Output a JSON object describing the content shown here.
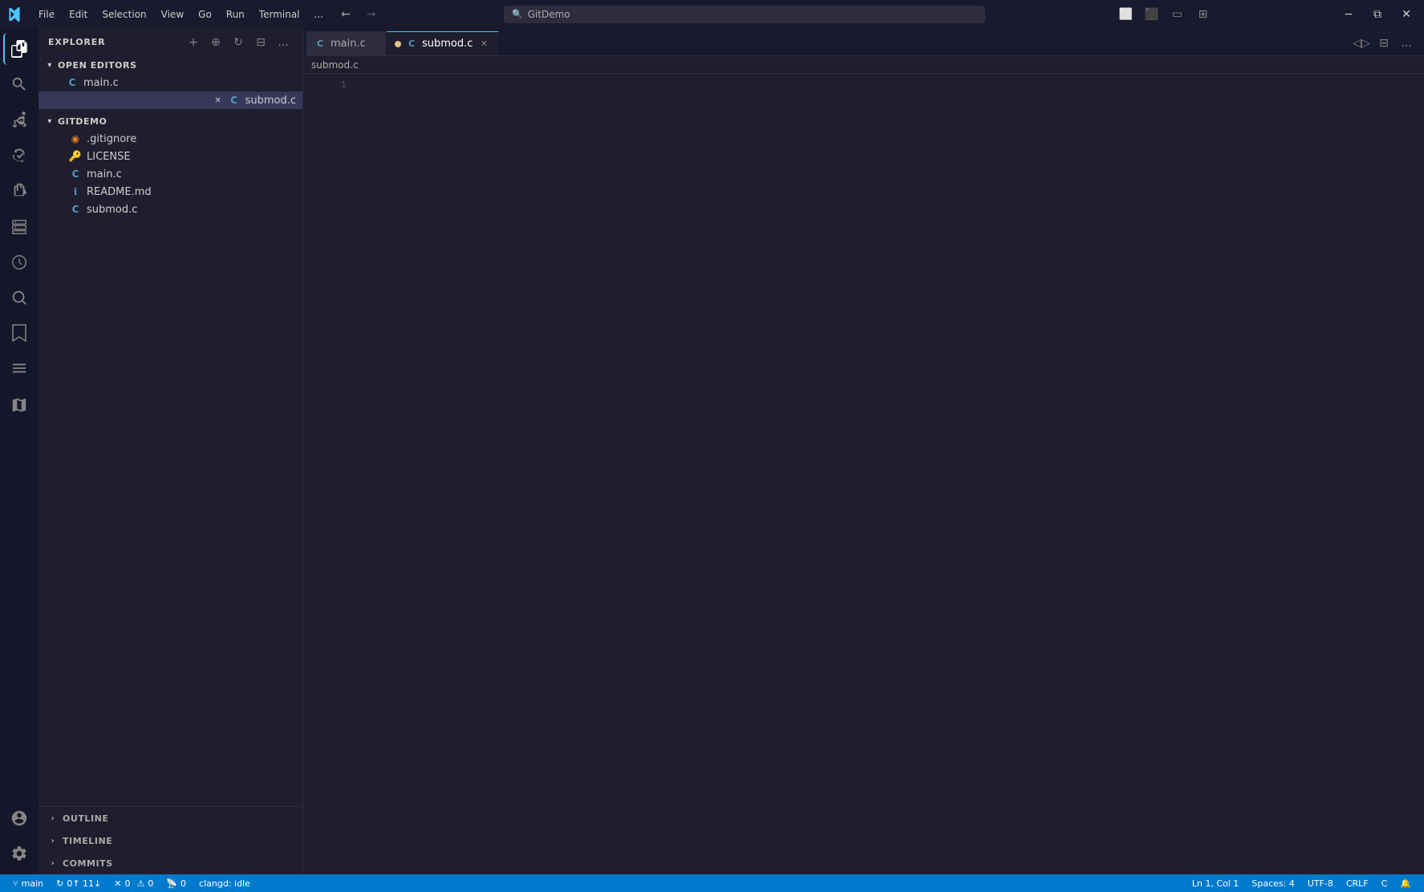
{
  "titleBar": {
    "appName": "GitDemo",
    "menuItems": [
      "File",
      "Edit",
      "Selection",
      "View",
      "Go",
      "Run",
      "Terminal",
      "..."
    ],
    "searchPlaceholder": "GitDemo",
    "windowControls": {
      "minimize": "−",
      "maximize": "□",
      "restore": "⧉",
      "close": "✕"
    }
  },
  "activityBar": {
    "items": [
      {
        "name": "explorer",
        "icon": "⊞",
        "label": "Explorer"
      },
      {
        "name": "search",
        "icon": "🔍",
        "label": "Search"
      },
      {
        "name": "source-control",
        "icon": "⑂",
        "label": "Source Control"
      },
      {
        "name": "run-debug",
        "icon": "▷",
        "label": "Run and Debug"
      },
      {
        "name": "extensions",
        "icon": "⊟",
        "label": "Extensions"
      },
      {
        "name": "remote-explorer",
        "icon": "⊡",
        "label": "Remote Explorer"
      },
      {
        "name": "timeline",
        "icon": "◷",
        "label": "Timeline"
      },
      {
        "name": "search-editor",
        "icon": "⌕",
        "label": "Search Editor"
      },
      {
        "name": "bookmarks",
        "icon": "🔖",
        "label": "Bookmarks"
      },
      {
        "name": "todo",
        "icon": "☰",
        "label": "Todo Tree"
      },
      {
        "name": "puzzle",
        "icon": "🧩",
        "label": "Puzzle"
      }
    ],
    "bottomItems": [
      {
        "name": "accounts",
        "icon": "👤",
        "label": "Accounts"
      },
      {
        "name": "settings",
        "icon": "⚙",
        "label": "Settings"
      }
    ]
  },
  "sidebar": {
    "title": "EXPLORER",
    "moreActions": "...",
    "sections": {
      "openEditors": {
        "label": "OPEN EDITORS",
        "files": [
          {
            "name": "main.c",
            "icon": "C",
            "iconColor": "#519aba",
            "modified": false
          },
          {
            "name": "submod.c",
            "icon": "C",
            "iconColor": "#519aba",
            "modified": true,
            "active": true
          }
        ]
      },
      "gitDemo": {
        "label": "GITDEMO",
        "files": [
          {
            "name": ".gitignore",
            "icon": "◉",
            "iconColor": "#e37e27"
          },
          {
            "name": "LICENSE",
            "icon": "🔑",
            "iconColor": "#e5c07b"
          },
          {
            "name": "main.c",
            "icon": "C",
            "iconColor": "#519aba"
          },
          {
            "name": "README.md",
            "icon": "ℹ",
            "iconColor": "#519aba"
          },
          {
            "name": "submod.c",
            "icon": "C",
            "iconColor": "#519aba"
          }
        ]
      }
    }
  },
  "sidebarBottom": {
    "panels": [
      {
        "name": "outline",
        "label": "OUTLINE"
      },
      {
        "name": "timeline",
        "label": "TIMELINE"
      },
      {
        "name": "commits",
        "label": "COMMITS"
      }
    ]
  },
  "tabs": [
    {
      "name": "main.c",
      "icon": "C",
      "active": false,
      "modified": false
    },
    {
      "name": "submod.c",
      "icon": "C",
      "active": true,
      "modified": true
    }
  ],
  "breadcrumb": {
    "path": "submod.c"
  },
  "editor": {
    "filename": "submod.c",
    "lines": [
      {
        "number": "1",
        "content": ""
      }
    ]
  },
  "statusBar": {
    "branch": "main",
    "sync": "0↑ 11↓",
    "errors": "0",
    "warnings": "0",
    "liveShare": "0",
    "position": "Ln 1, Col 1",
    "spaces": "Spaces: 4",
    "encoding": "UTF-8",
    "lineEnding": "CRLF",
    "language": "C",
    "notifications": "",
    "clangd": "clangd: idle"
  }
}
